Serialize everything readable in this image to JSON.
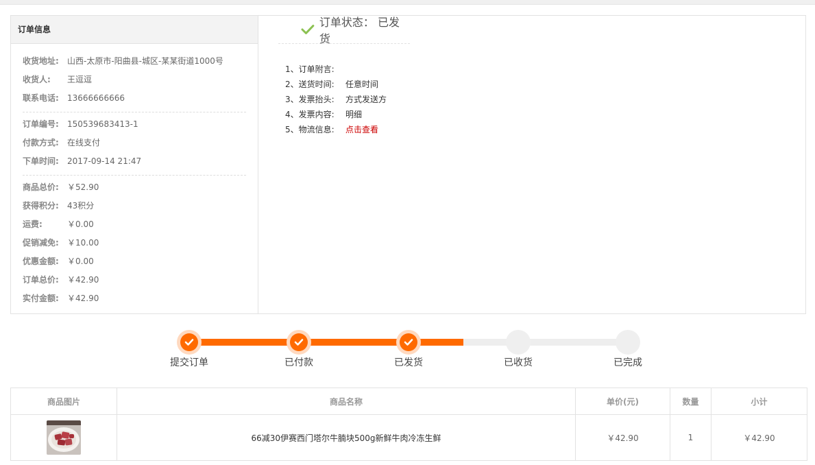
{
  "order_info": {
    "title": "订单信息",
    "group1": [
      {
        "label": "收货地址:",
        "value": "山西-太原市-阳曲县-城区-某某街道1000号"
      },
      {
        "label": "收货人:",
        "value": "王逗逗"
      },
      {
        "label": "联系电话:",
        "value": "13666666666"
      }
    ],
    "group2": [
      {
        "label": "订单编号:",
        "value": "150539683413-1"
      },
      {
        "label": "付款方式:",
        "value": "在线支付"
      },
      {
        "label": "下单时间:",
        "value": "2017-09-14 21:47"
      }
    ],
    "group3": [
      {
        "label": "商品总价:",
        "value": "￥52.90"
      },
      {
        "label": "获得积分:",
        "value": "43积分"
      },
      {
        "label": "运费:",
        "value": "￥0.00"
      },
      {
        "label": "促销减免:",
        "value": "￥10.00"
      },
      {
        "label": "优惠金额:",
        "value": "￥0.00"
      },
      {
        "label": "订单总价:",
        "value": "￥42.90"
      },
      {
        "label": "实付金额:",
        "value": "￥42.90"
      }
    ]
  },
  "status": {
    "text": "订单状态： 已发货",
    "check_color": "#8cc152",
    "remarks": [
      {
        "label": "1、订单附言:",
        "value": ""
      },
      {
        "label": "2、送货时间:",
        "value": "任意时间"
      },
      {
        "label": "3、发票抬头:",
        "value": "方式发送方"
      },
      {
        "label": "4、发票内容:",
        "value": "明细"
      },
      {
        "label": "5、物流信息:",
        "value": "点击查看",
        "link": true
      }
    ]
  },
  "progress": {
    "accent": "#ff6a00",
    "steps": [
      {
        "label": "提交订单",
        "done": true
      },
      {
        "label": "已付款",
        "done": true
      },
      {
        "label": "已发货",
        "done": true
      },
      {
        "label": "已收货",
        "done": false
      },
      {
        "label": "已完成",
        "done": false
      }
    ]
  },
  "goods": {
    "headers": [
      "商品图片",
      "商品名称",
      "单价(元)",
      "数量",
      "小计"
    ],
    "rows": [
      {
        "image_icon": "meat-product-thumbnail",
        "name": "66减30伊赛西门塔尔牛腩块500g新鲜牛肉冷冻生鲜",
        "price": "￥42.90",
        "qty": "1",
        "subtotal": "￥42.90"
      }
    ]
  }
}
